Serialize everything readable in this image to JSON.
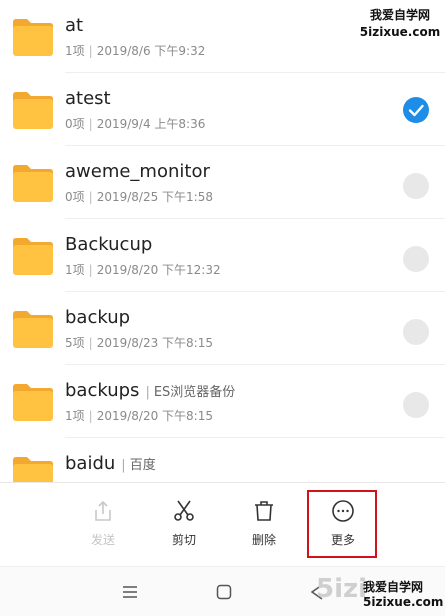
{
  "colors": {
    "folder": "#ffc341",
    "folder_tab": "#f3a930",
    "selected": "#1e8de8",
    "highlight_box": "#d0121b"
  },
  "files": [
    {
      "name": "at",
      "tag": "",
      "count": "1项",
      "date": "2019/8/6 下午9:32",
      "selected": false,
      "radio_visible": false
    },
    {
      "name": "atest",
      "tag": "",
      "count": "0项",
      "date": "2019/9/4 上午8:36",
      "selected": true,
      "radio_visible": true
    },
    {
      "name": "aweme_monitor",
      "tag": "",
      "count": "0项",
      "date": "2019/8/25 下午1:58",
      "selected": false,
      "radio_visible": true
    },
    {
      "name": "Backucup",
      "tag": "",
      "count": "1项",
      "date": "2019/8/20 下午12:32",
      "selected": false,
      "radio_visible": true
    },
    {
      "name": "backup",
      "tag": "",
      "count": "5项",
      "date": "2019/8/23 下午8:15",
      "selected": false,
      "radio_visible": true
    },
    {
      "name": "backups",
      "tag": "ES浏览器备份",
      "count": "1项",
      "date": "2019/8/20 下午8:15",
      "selected": false,
      "radio_visible": true
    },
    {
      "name": "baidu",
      "tag": "百度",
      "count": "",
      "date": "",
      "selected": false,
      "radio_visible": false
    }
  ],
  "toolbar": {
    "send": {
      "label": "发送",
      "icon": "share-icon",
      "enabled": false
    },
    "cut": {
      "label": "剪切",
      "icon": "scissors-icon",
      "enabled": true
    },
    "delete": {
      "label": "删除",
      "icon": "trash-icon",
      "enabled": true
    },
    "more": {
      "label": "更多",
      "icon": "more-icon",
      "enabled": true,
      "highlighted": true
    }
  },
  "navbar": {
    "menu_icon": "menu-icon",
    "home_icon": "home-icon",
    "back_icon": "back-icon"
  },
  "watermark": {
    "top_line1": "我爱自学网",
    "top_line2": "5izixue.com",
    "bottom_big": "5izi",
    "bottom_line1": "我爱自学网",
    "bottom_line2": "5izixue.com"
  }
}
